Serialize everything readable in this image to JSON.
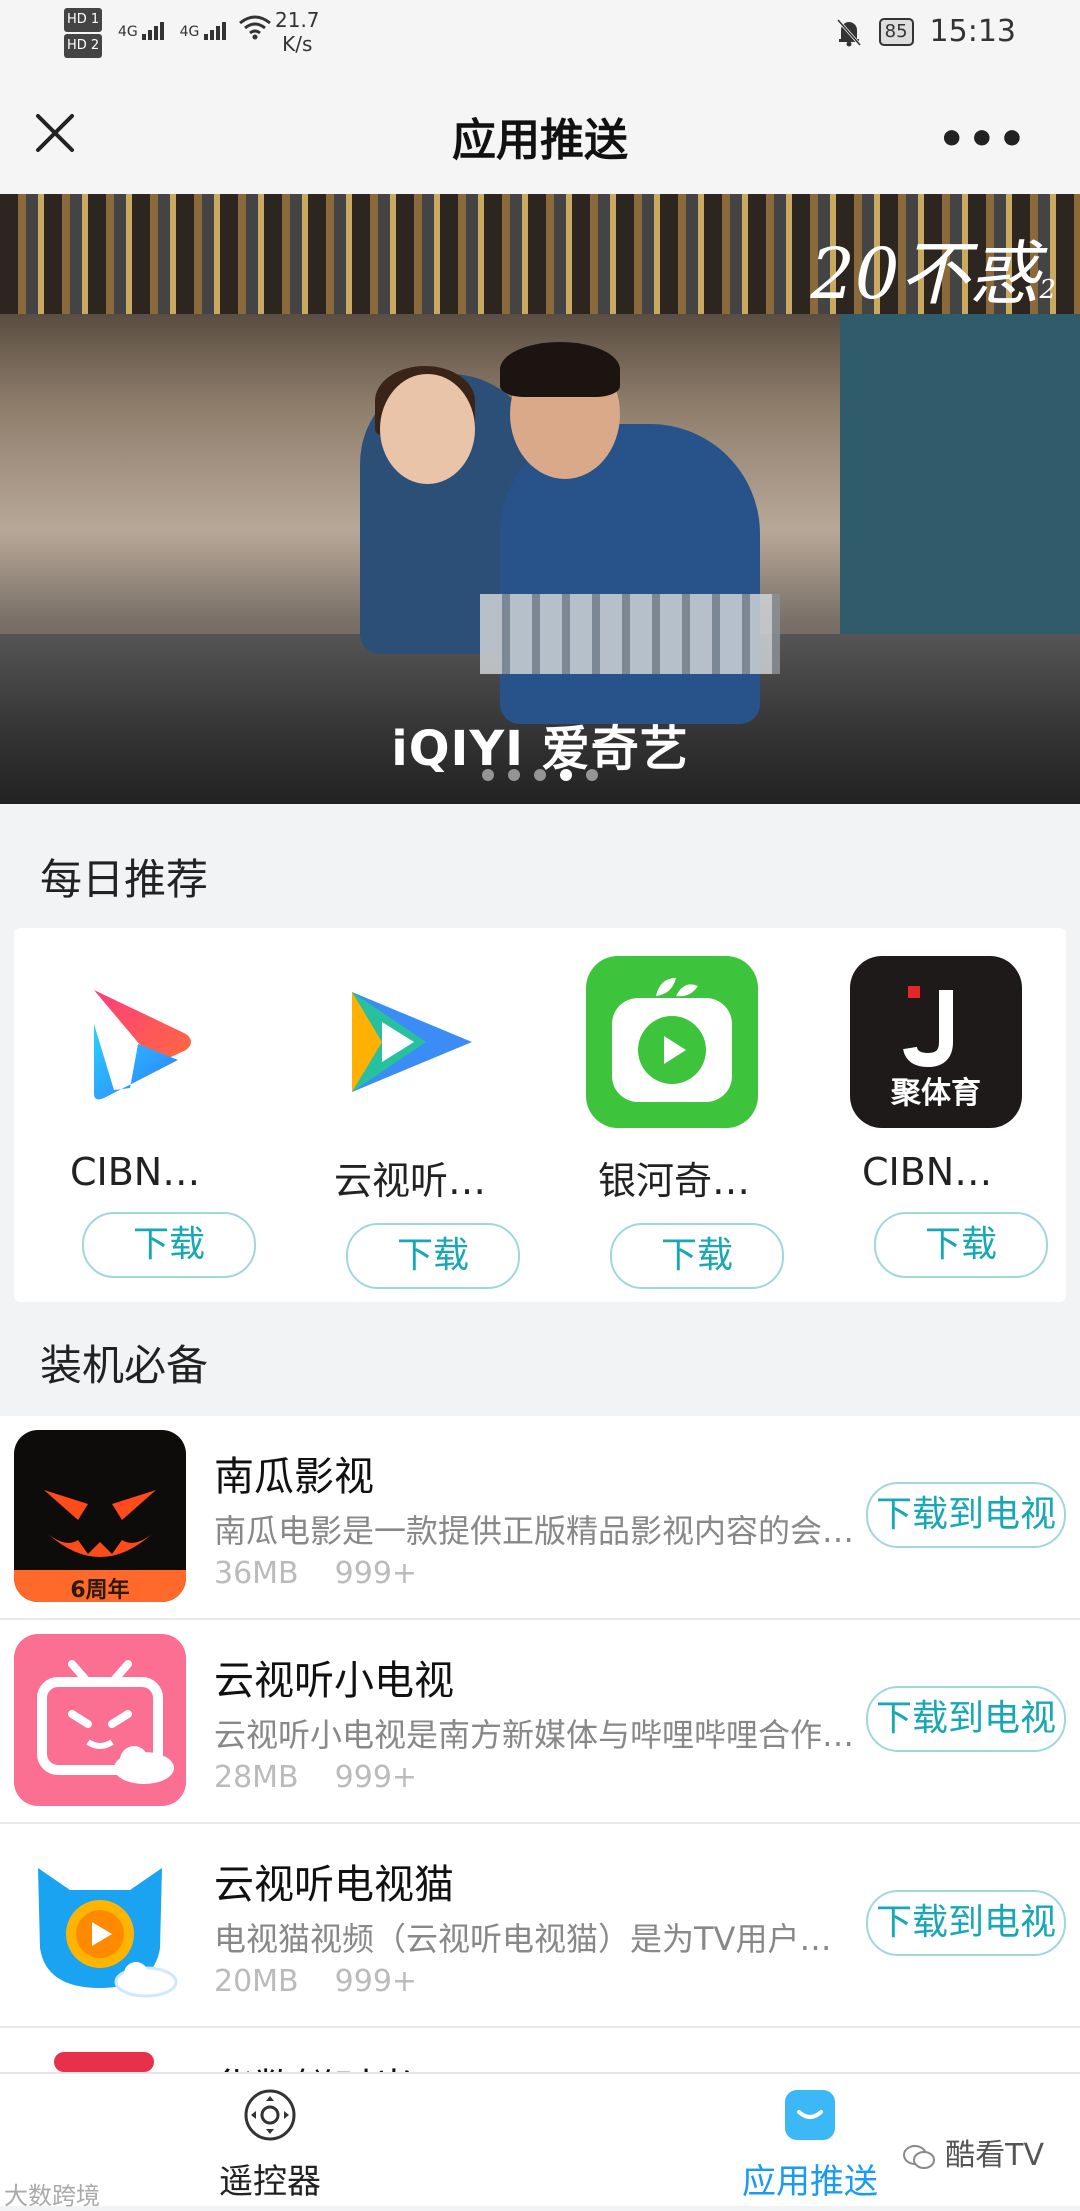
{
  "status_bar": {
    "hd1": "HD 1",
    "hd2": "HD 2",
    "net1": "4G",
    "net2": "4G",
    "speed_value": "21.7",
    "speed_unit": "K/s",
    "battery": "85",
    "time": "15:13"
  },
  "titlebar": {
    "title": "应用推送",
    "more": "•••"
  },
  "banner": {
    "show_title": "20不惑",
    "show_suffix": "2",
    "brand": "iQIYI 爱奇艺",
    "slide_index": 4,
    "slide_count": 5
  },
  "daily": {
    "title": "每日推荐",
    "apps": [
      {
        "name": "CIBN…",
        "button": "下载",
        "icon": "play-gradient-icon"
      },
      {
        "name": "云视听…",
        "button": "下载",
        "icon": "tencent-video-icon"
      },
      {
        "name": "银河奇…",
        "button": "下载",
        "icon": "green-tv-icon"
      },
      {
        "name": "CIBN…",
        "button": "下载",
        "icon": "sports-j-icon",
        "icon_text": "聚体育"
      }
    ]
  },
  "essentials": {
    "title": "装机必备",
    "apps": [
      {
        "name": "南瓜影视",
        "desc": "南瓜电影是一款提供正版精品影视内容的会…",
        "size": "36MB",
        "count": "999+",
        "button": "下载到电视",
        "badge": "6周年"
      },
      {
        "name": "云视听小电视",
        "desc": "云视听小电视是南方新媒体与哔哩哔哩合作…",
        "size": "28MB",
        "count": "999+",
        "button": "下载到电视"
      },
      {
        "name": "云视听电视猫",
        "desc": "电视猫视频（云视听电视猫）是为TV用户…",
        "size": "20MB",
        "count": "999+",
        "button": "下载到电视"
      },
      {
        "name": "华数鲜时光",
        "desc": "",
        "size": "",
        "count": "",
        "button": ""
      }
    ]
  },
  "tabbar": {
    "remote": "遥控器",
    "push": "应用推送"
  },
  "watermark": {
    "left": "大数跨境",
    "right": "酷看TV"
  },
  "colors": {
    "accent": "#18a7b4",
    "active_tab": "#1a9bf0"
  }
}
